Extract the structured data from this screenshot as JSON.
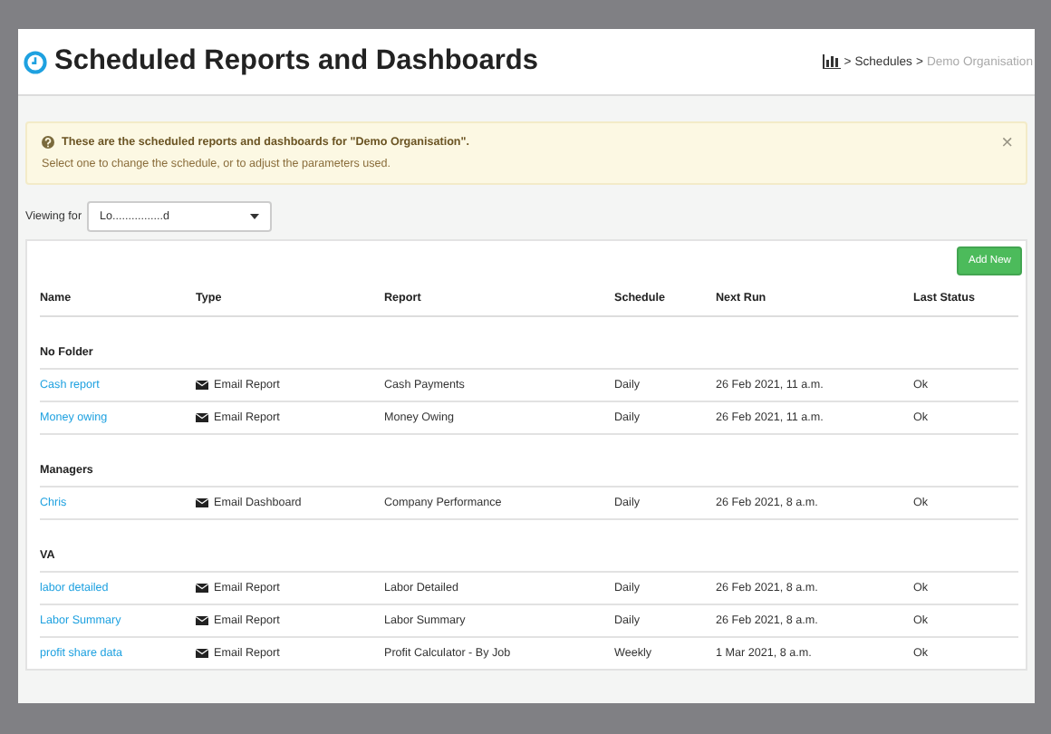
{
  "header": {
    "title": "Scheduled Reports and Dashboards",
    "breadcrumb": [
      {
        "kind": "icon"
      },
      {
        "kind": "link",
        "separator": ">",
        "label": "Schedules"
      },
      {
        "kind": "current",
        "separator": ">",
        "label": "Demo Organisation"
      }
    ]
  },
  "alert": {
    "title": "These are the scheduled reports and dashboards for \"Demo Organisation\".",
    "message": "Select one to change the schedule, or to adjust the parameters used.",
    "dismiss": "×"
  },
  "viewing_for": {
    "label": "Viewing for",
    "value": "Lo................d"
  },
  "add_button": "Add New",
  "table": {
    "columns": [
      "Name",
      "Type",
      "Report",
      "Schedule",
      "Next Run",
      "Last Status"
    ],
    "groups": [
      {
        "folder": "No Folder",
        "rows": [
          {
            "name": "Cash report",
            "type": "Email Report",
            "report": "Cash Payments",
            "schedule": "Daily",
            "next_run": "26 Feb 2021, 11 a.m.",
            "last_status": "Ok"
          },
          {
            "name": "Money owing",
            "type": "Email Report",
            "report": "Money Owing",
            "schedule": "Daily",
            "next_run": "26 Feb 2021, 11 a.m.",
            "last_status": "Ok"
          }
        ]
      },
      {
        "folder": "Managers",
        "rows": [
          {
            "name": "Chris",
            "type": "Email Dashboard",
            "report": "Company Performance",
            "schedule": "Daily",
            "next_run": "26 Feb 2021, 8 a.m.",
            "last_status": "Ok"
          }
        ]
      },
      {
        "folder": "VA",
        "rows": [
          {
            "name": "labor detailed",
            "type": "Email Report",
            "report": "Labor Detailed",
            "schedule": "Daily",
            "next_run": "26 Feb 2021, 8 a.m.",
            "last_status": "Ok"
          },
          {
            "name": "Labor Summary",
            "type": "Email Report",
            "report": "Labor Summary",
            "schedule": "Daily",
            "next_run": "26 Feb 2021, 8 a.m.",
            "last_status": "Ok"
          },
          {
            "name": "profit share data",
            "type": "Email Report",
            "report": "Profit Calculator - By Job",
            "schedule": "Weekly",
            "next_run": "1 Mar 2021, 8 a.m.",
            "last_status": "Ok"
          }
        ]
      }
    ]
  }
}
